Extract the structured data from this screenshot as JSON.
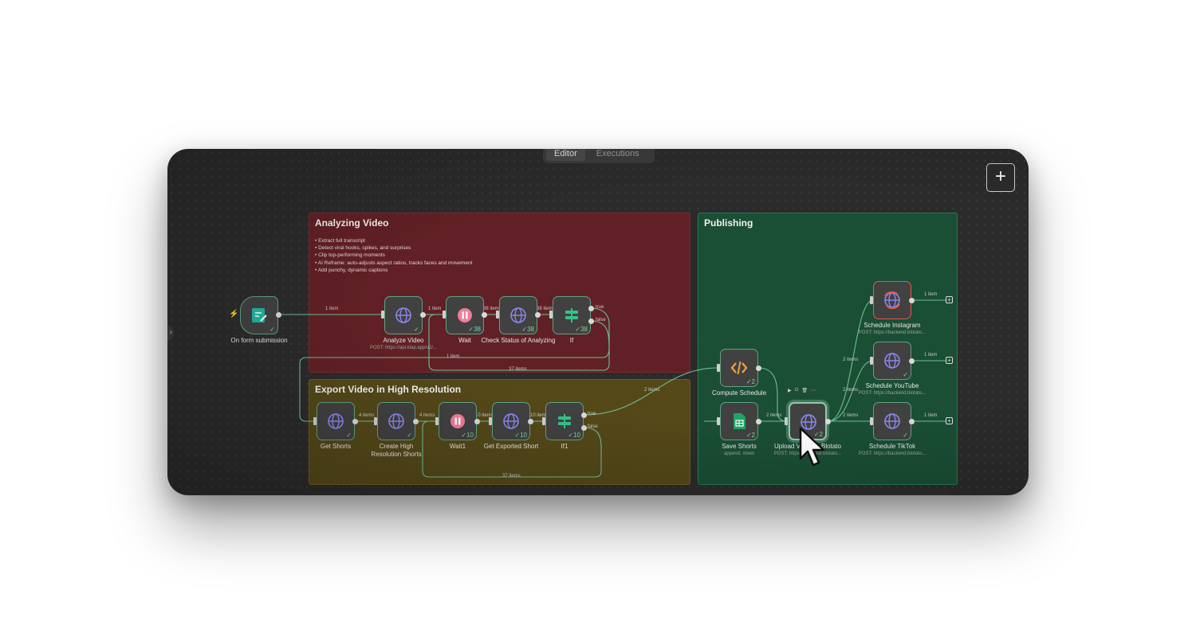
{
  "tabs": {
    "editor": "Editor",
    "executions": "Executions"
  },
  "add_button": "+",
  "groups": {
    "analyze": {
      "title": "Analyzing Video",
      "notes": [
        "Extract full transcript",
        "Detect viral hooks, spikes, and surprises",
        "Clip top-performing moments",
        "AI Reframe: auto-adjusts aspect ratios, tracks faces and movement",
        "Add punchy, dynamic captions"
      ]
    },
    "export": {
      "title": "Export Video in High Resolution"
    },
    "publish": {
      "title": "Publishing"
    }
  },
  "nodes": {
    "form": {
      "label": "On form submission",
      "icon": "form-icon"
    },
    "analyze": {
      "label": "Analyze Video",
      "sub": "POST: https://api.klap.app/v2/...",
      "icon": "globe-icon"
    },
    "wait": {
      "label": "Wait",
      "badge": "38",
      "icon": "pause-icon"
    },
    "check": {
      "label": "Check Status of Analyzing",
      "badge": "38",
      "icon": "globe-icon"
    },
    "if": {
      "label": "If",
      "badge": "38",
      "icon": "if-icon",
      "true_label": "true",
      "false_label": "false"
    },
    "getshorts": {
      "label": "Get Shorts",
      "icon": "globe-icon"
    },
    "create": {
      "label": "Create High Resolution Shorts",
      "icon": "globe-icon"
    },
    "wait1": {
      "label": "Wait1",
      "badge": "10",
      "icon": "pause-icon"
    },
    "getexported": {
      "label": "Get Exported Short",
      "badge": "10",
      "icon": "globe-icon"
    },
    "if1": {
      "label": "If1",
      "badge": "10",
      "icon": "if-icon",
      "true_label": "true",
      "false_label": "false"
    },
    "compute": {
      "label": "Compute Schedule",
      "badge": "2",
      "icon": "code-icon"
    },
    "save": {
      "label": "Save Shorts",
      "sub": "append: sheet",
      "badge": "2",
      "icon": "sheets-icon"
    },
    "upload": {
      "label": "Upload Video to Blotato",
      "sub": "POST: https://backend.blotato...",
      "badge": "2",
      "icon": "globe-icon"
    },
    "instagram": {
      "label": "Schedule Instagram",
      "sub": "POST: https://backend.blotato...",
      "icon": "globe-icon"
    },
    "youtube": {
      "label": "Schedule YouTube",
      "sub": "POST: https://backend.blotato...",
      "icon": "globe-icon"
    },
    "tiktok": {
      "label": "Schedule TikTok",
      "sub": "POST: https://backend.blotato...",
      "icon": "globe-icon"
    }
  },
  "edges": {
    "form_analyze": "1 item",
    "analyze_wait": "1 item",
    "wait_check": "38 items",
    "check_if": "38 items",
    "if_loop": "37 items",
    "if_export": "1 item",
    "shorts_create": "4 items",
    "create_wait1": "4 items",
    "wait1_get": "10 items",
    "get_if1": "10 items",
    "if1_loop": "37 items",
    "if1_compute": "2 items",
    "save_upload": "2 items",
    "compute_upload": "2 items",
    "upload_instagram": "2 items",
    "upload_tiktok": "2 items",
    "instagram_out": "1 item",
    "youtube_out": "1 item",
    "tiktok_out": "1 item"
  },
  "toolbar": [
    "▶",
    "⏻",
    "🗑",
    "⋯"
  ],
  "colors": {
    "analyze_group": "#6e1e24",
    "export_group": "#5c4e16",
    "publish_group": "#185236",
    "node_border": "#5ea383",
    "success": "#7fd1a3"
  }
}
